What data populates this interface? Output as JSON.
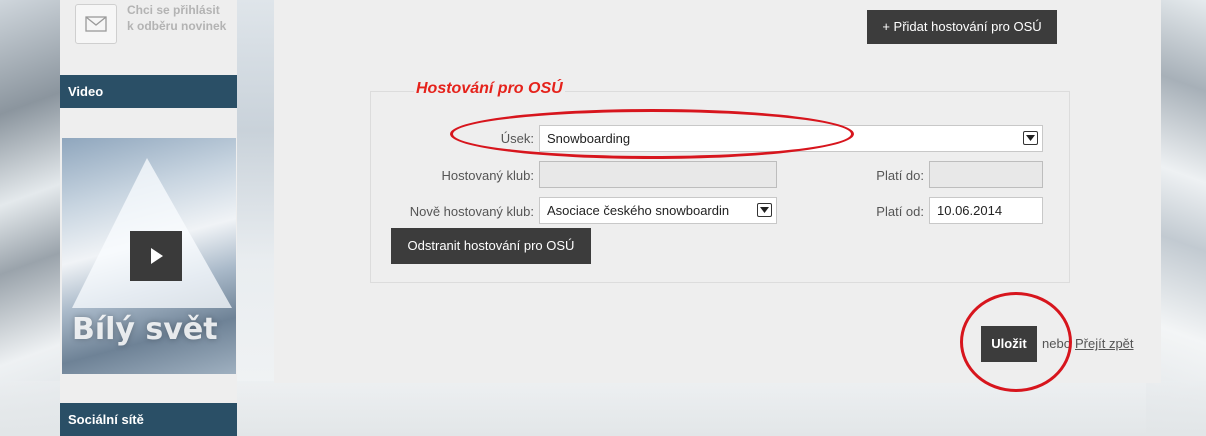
{
  "sidebar": {
    "newsletter": {
      "icon": "mail-icon",
      "line1": "Chci se přihlásit",
      "line2": "k odběru novinek"
    },
    "video_header": "Video",
    "video_title": "Bílý svět",
    "social_header": "Sociální sítě"
  },
  "toolbar": {
    "add_label": "+ Přidat hostování pro OSÚ"
  },
  "form": {
    "title": "Hostování pro OSÚ",
    "usek": {
      "label": "Úsek:",
      "value": "Snowboarding"
    },
    "hostovany_klub": {
      "label": "Hostovaný klub:",
      "value": ""
    },
    "plati_do": {
      "label": "Platí do:",
      "value": ""
    },
    "nove_hostovany_klub": {
      "label": "Nově hostovaný klub:",
      "value": "Asociace českého snowboardin"
    },
    "plati_od": {
      "label": "Platí od:",
      "value": "10.06.2014"
    },
    "remove_label": "Odstranit hostování pro OSÚ"
  },
  "footer": {
    "save_label": "Uložit",
    "or_text": "nebo",
    "back_label": "Přejít zpět"
  },
  "colors": {
    "accent_title": "#e5221b",
    "sidebar_header": "#2a4f66",
    "button_dark": "#3c3c3c",
    "annotation": "#d7151d"
  }
}
